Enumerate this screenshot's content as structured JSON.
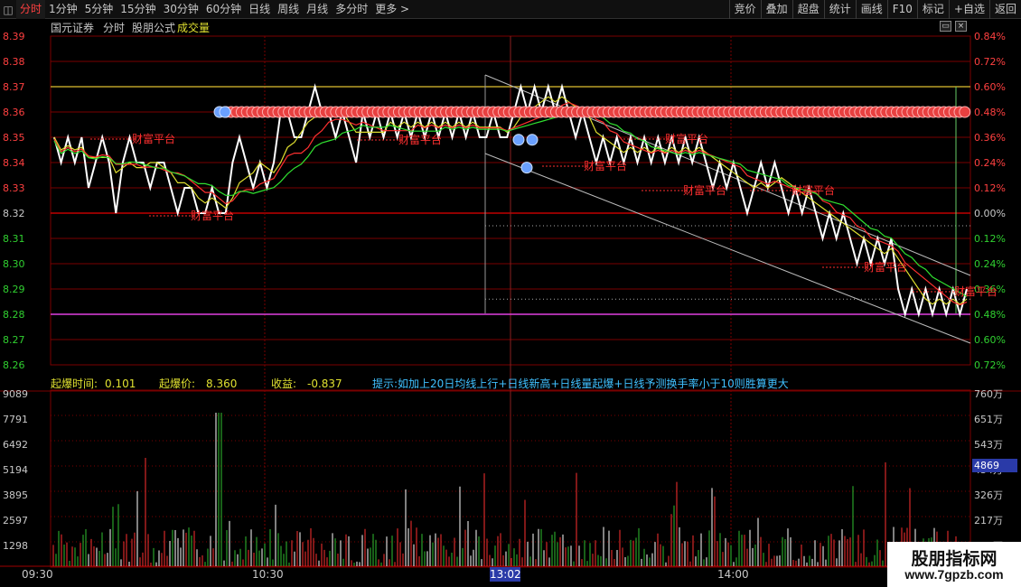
{
  "toolbar": {
    "tabs": [
      "分时",
      "1分钟",
      "5分钟",
      "15分钟",
      "30分钟",
      "60分钟",
      "日线",
      "周线",
      "月线",
      "多分时",
      "更多 >"
    ],
    "buttons": [
      "竞价",
      "叠加",
      "超盘",
      "统计",
      "画线",
      "F10",
      "标记",
      "+自选",
      "返回"
    ]
  },
  "info": {
    "broker": "国元证券",
    "mode": "分时",
    "formula": "股朋公式",
    "volume_label": "成交量"
  },
  "price_axis": [
    "8.39",
    "8.38",
    "8.37",
    "8.36",
    "8.35",
    "8.34",
    "8.33",
    "8.32",
    "8.31",
    "8.30",
    "8.29",
    "8.28",
    "8.27",
    "8.26"
  ],
  "pct_axis": [
    "0.84%",
    "0.72%",
    "0.60%",
    "0.48%",
    "0.36%",
    "0.24%",
    "0.12%",
    "0.00%",
    "0.12%",
    "0.24%",
    "0.36%",
    "0.48%",
    "0.60%",
    "0.72%"
  ],
  "vol_axis_left": [
    "9089",
    "7791",
    "6492",
    "5194",
    "3895",
    "2597",
    "1298"
  ],
  "vol_axis_right": [
    "760万",
    "651万",
    "543万",
    "434万",
    "326万",
    "217万",
    "108万"
  ],
  "stats": {
    "burst_time_label": "起爆时间:",
    "burst_time": "0.101",
    "burst_price_label": "起爆价:",
    "burst_price": "8.360",
    "profit_label": "收益:",
    "profit": "-0.837",
    "tip": "提示:如加上20日均线上行+日线新高+日线量起爆+日线予测换手率小于10则胜算更大"
  },
  "current_volume": "4869",
  "time_axis": [
    "09:30",
    "10:30",
    "14:00"
  ],
  "cursor_time": "13:02",
  "annotation": "财富平台",
  "watermark": {
    "title": "股朋指标网",
    "url": "www.7gpzb.com"
  },
  "colors": {
    "up": "#ff3030",
    "down": "#30ff30",
    "price": "#ffffff",
    "axis_up": "#ff4040",
    "axis_down": "#30d030",
    "grid": "#7a0000",
    "tip": "#40c0ff",
    "yellow": "#e0e030",
    "magenta": "#e040e0"
  },
  "chart_data": {
    "type": "line",
    "title": "",
    "ylim": [
      8.26,
      8.39
    ],
    "base_price": 8.32,
    "price": [
      8.35,
      8.34,
      8.35,
      8.34,
      8.35,
      8.33,
      8.34,
      8.35,
      8.34,
      8.32,
      8.34,
      8.35,
      8.34,
      8.34,
      8.33,
      8.34,
      8.34,
      8.33,
      8.32,
      8.33,
      8.33,
      8.32,
      8.32,
      8.33,
      8.32,
      8.32,
      8.34,
      8.35,
      8.34,
      8.33,
      8.34,
      8.33,
      8.34,
      8.36,
      8.36,
      8.35,
      8.35,
      8.36,
      8.37,
      8.36,
      8.36,
      8.35,
      8.36,
      8.35,
      8.34,
      8.36,
      8.35,
      8.36,
      8.35,
      8.36,
      8.35,
      8.36,
      8.35,
      8.36,
      8.35,
      8.36,
      8.35,
      8.36,
      8.35,
      8.36,
      8.35,
      8.36,
      8.35,
      8.35,
      8.36,
      8.35,
      8.35,
      8.36,
      8.37,
      8.36,
      8.37,
      8.36,
      8.37,
      8.36,
      8.37,
      8.36,
      8.35,
      8.36,
      8.35,
      8.34,
      8.35,
      8.34,
      8.35,
      8.34,
      8.35,
      8.34,
      8.35,
      8.34,
      8.35,
      8.34,
      8.35,
      8.34,
      8.35,
      8.34,
      8.35,
      8.34,
      8.33,
      8.34,
      8.33,
      8.34,
      8.33,
      8.32,
      8.33,
      8.34,
      8.33,
      8.34,
      8.33,
      8.32,
      8.33,
      8.32,
      8.33,
      8.32,
      8.31,
      8.32,
      8.31,
      8.32,
      8.31,
      8.3,
      8.31,
      8.3,
      8.31,
      8.3,
      8.31,
      8.29,
      8.28,
      8.29,
      8.28,
      8.29,
      8.28,
      8.29,
      8.28,
      8.29,
      8.28,
      8.29
    ]
  }
}
